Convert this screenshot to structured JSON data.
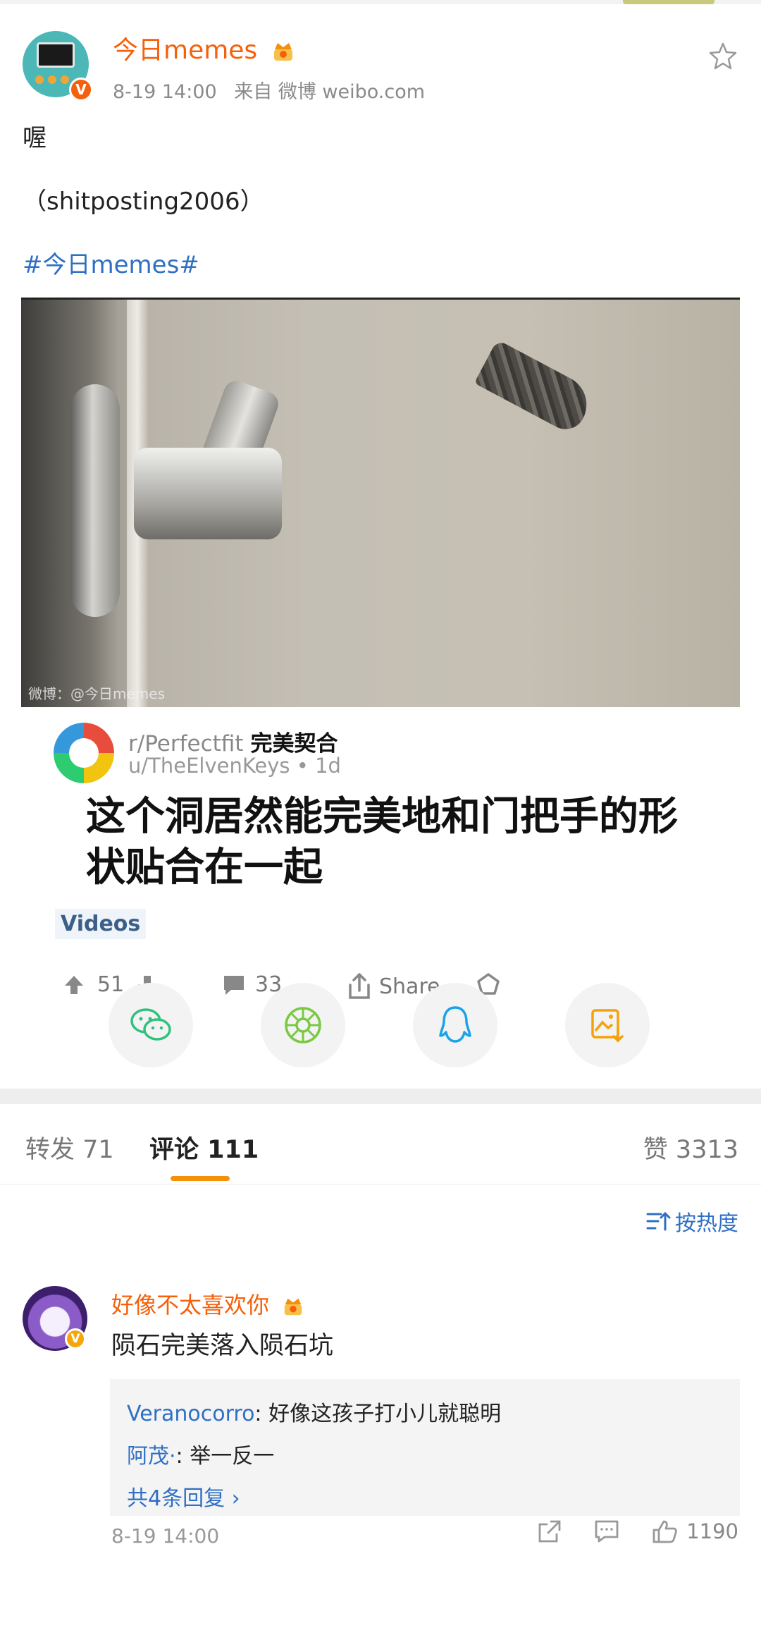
{
  "post": {
    "username": "今日memes",
    "time": "8-19 14:00",
    "source": "来自 微博 weibo.com",
    "text_line1": "喔",
    "text_line2": "（shitposting2006）",
    "hashtag": "#今日memes#",
    "verified_badge": "V"
  },
  "media": {
    "watermark": "微博：@今日memes",
    "reddit": {
      "subreddit": "r/Perfectfit",
      "subreddit_cn": "完美契合",
      "user": "u/TheElvenKeys • 1d",
      "title": "这个洞居然能完美地和门把手的形状贴合在一起",
      "flair": "Videos",
      "upvotes": "51",
      "comments": "33",
      "share": "Share"
    }
  },
  "share_targets": [
    "wechat-icon",
    "moments-icon",
    "qq-icon",
    "save-image-icon"
  ],
  "tabs": {
    "repost": "转发 71",
    "comment": "评论 111",
    "likes": "赞 3313"
  },
  "sort": {
    "label": "按热度"
  },
  "comment": {
    "name": "好像不太喜欢你",
    "text": "陨石完美落入陨石坑",
    "badge": "V",
    "replies": [
      {
        "name": "Veranocorro",
        "text": ": 好像这孩子打小儿就聪明"
      },
      {
        "name": "阿茂·",
        "text": ": 举一反一"
      }
    ],
    "more": "共4条回复",
    "time": "8-19 14:00",
    "like_count": "1190"
  },
  "colors": {
    "accent_orange": "#f5600a",
    "link_blue": "#2f6fc4",
    "tab_underline": "#f5900a"
  }
}
